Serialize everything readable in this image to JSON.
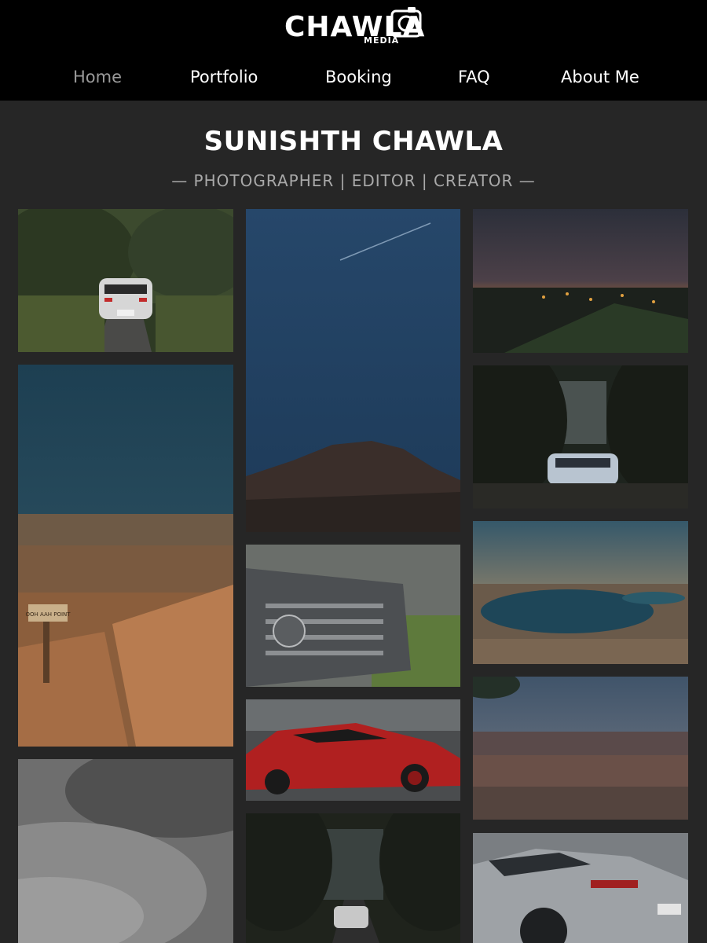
{
  "brand": {
    "logo_text": "CHAWLA",
    "logo_sub": "MEDIA"
  },
  "nav": {
    "items": [
      {
        "label": "Home",
        "active": true
      },
      {
        "label": "Portfolio",
        "active": false
      },
      {
        "label": "Booking",
        "active": false
      },
      {
        "label": "FAQ",
        "active": false
      },
      {
        "label": "About Me",
        "active": false
      }
    ]
  },
  "hero": {
    "title": "SUNISHTH CHAWLA",
    "subtitle": "— PHOTOGRAPHER | EDITOR | CREATOR —"
  },
  "gallery": {
    "photos": [
      {
        "subject": "white hatchback on wooded road"
      },
      {
        "subject": "Grand Canyon overlook with Ooh Aah Point sign"
      },
      {
        "subject": "black and white car close-up"
      },
      {
        "subject": "mountain ridge under blue sky with contrail"
      },
      {
        "subject": "car grille with badge close-up"
      },
      {
        "subject": "red Lamborghini at car show"
      },
      {
        "subject": "white hatchback on dark forest road"
      },
      {
        "subject": "sunset city skyline"
      },
      {
        "subject": "blue hatchback in dark forest"
      },
      {
        "subject": "lake at dusk"
      },
      {
        "subject": "Grand Canyon panorama"
      },
      {
        "subject": "grey BMW coupe rear"
      }
    ],
    "sign_text": "OOH AAH POINT"
  },
  "colors": {
    "header_bg": "#000000",
    "page_bg": "#262626",
    "nav_active": "#9a9a9a",
    "subtitle": "#a9a9a9"
  }
}
